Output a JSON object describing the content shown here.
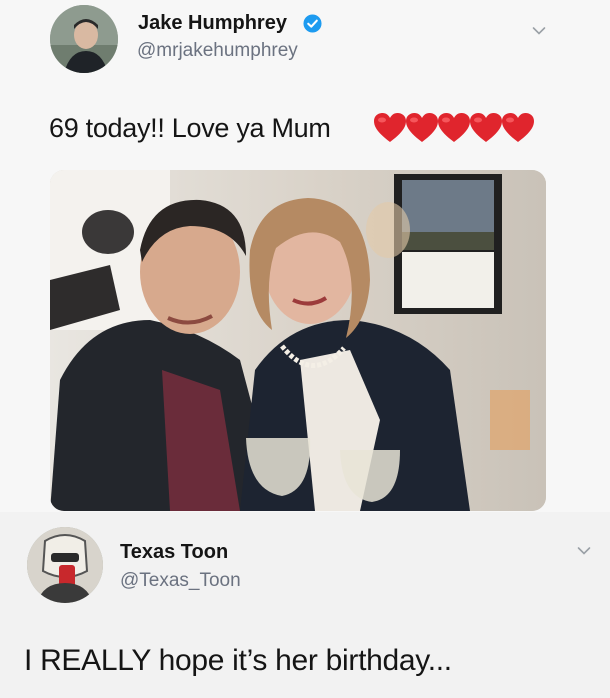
{
  "tweet": {
    "author_name": "Jake Humphrey",
    "author_handle": "@mrjakehumphrey",
    "verified": true,
    "text": "69 today!! Love ya Mum",
    "emoji": [
      "red-heart",
      "red-heart",
      "red-heart",
      "red-heart",
      "red-heart"
    ]
  },
  "reply": {
    "author_name": "Texas Toon",
    "author_handle": "@Texas_Toon",
    "text": "I REALLY hope it’s her birthday..."
  },
  "colors": {
    "verified_blue": "#1d9bf0",
    "heart_red": "#e0252d",
    "handle_gray": "#6b7280"
  }
}
